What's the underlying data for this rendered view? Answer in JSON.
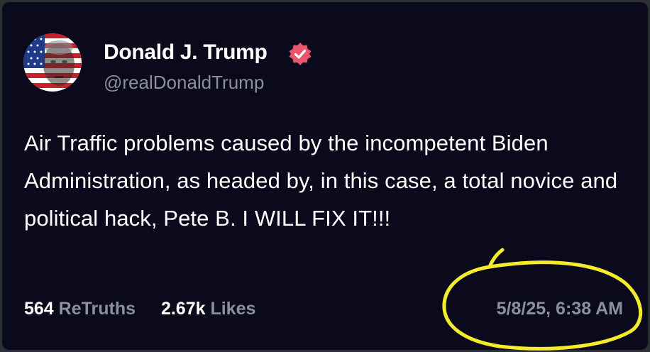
{
  "post": {
    "author": {
      "display_name": "Donald J. Trump",
      "handle": "@realDonaldTrump",
      "verified_icon": "verified-badge-icon"
    },
    "text": "Air Traffic problems caused by the incompetent Biden Administration, as headed by, in this case, a total novice and political hack, Pete B. I WILL FIX IT!!!",
    "stats": {
      "retruths_count": "564",
      "retruths_label": "ReTruths",
      "likes_count": "2.67k",
      "likes_label": "Likes"
    },
    "timestamp": "5/8/25, 6:38 AM"
  },
  "colors": {
    "background": "#0a0a1c",
    "text_primary": "#ffffff",
    "text_secondary": "#8b8f9e",
    "verified_badge": "#e8566e",
    "highlight_circle": "#f2ec2a"
  }
}
